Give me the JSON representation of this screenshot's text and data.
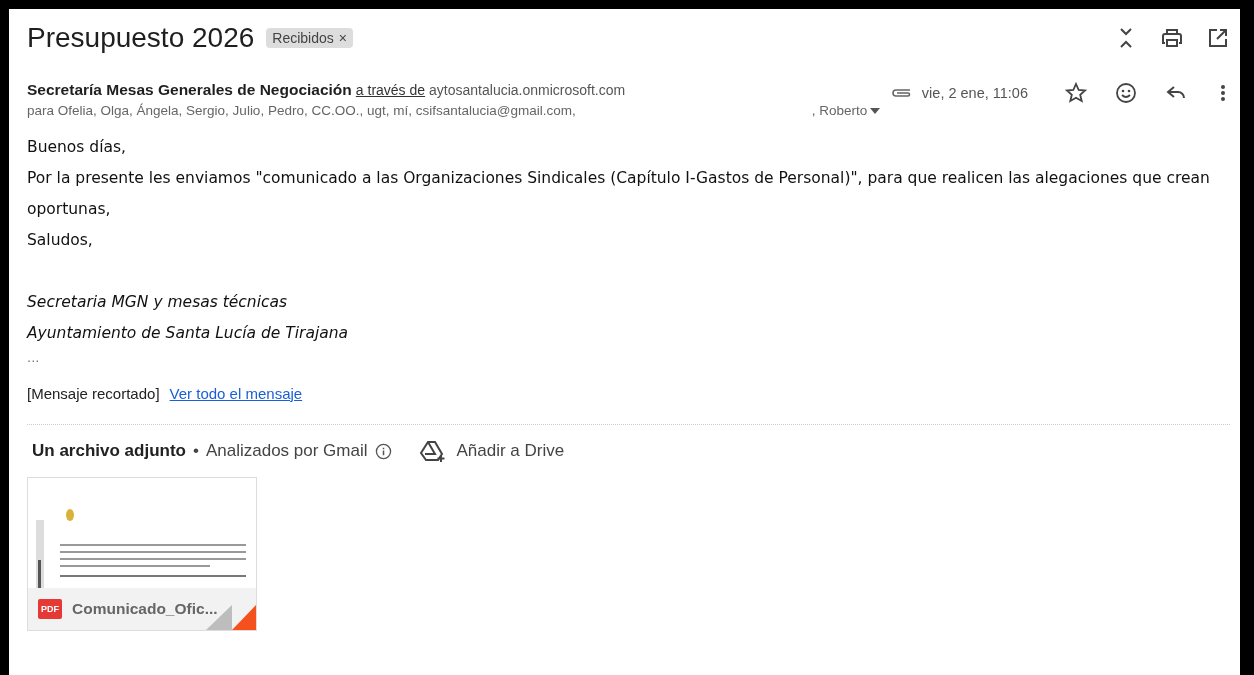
{
  "subject": "Presupuesto 2026",
  "label": {
    "text": "Recibidos",
    "remove": "×"
  },
  "sender": {
    "name": "Secretaría Mesas Generales de Negociación",
    "via_link": "a través de",
    "via_domain": "aytosantalucia.onmicrosoft.com"
  },
  "recipients": {
    "visible": "para Ofelia, Olga, Ángela, Sergio, Julio, Pedro, CC.OO., ugt, mí, csifsantalucia@gmail.com,",
    "tail": ", Roberto"
  },
  "date": "vie, 2 ene, 11:06",
  "has_attachment": true,
  "starred": false,
  "body": [
    {
      "kind": "text",
      "text": "Buenos días,"
    },
    {
      "kind": "text",
      "text": "Por la presente les enviamos \"comunicado a las Organizaciones Sindicales (Capítulo I-Gastos de Personal)\", para que realicen las alegaciones que crean oportunas,"
    },
    {
      "kind": "text",
      "text": "Saludos,"
    },
    {
      "kind": "gap"
    },
    {
      "kind": "signature",
      "text": "Secretaria MGN  y mesas técnicas"
    },
    {
      "kind": "signature",
      "text": "Ayuntamiento de Santa Lucía de Tirajana"
    },
    {
      "kind": "ellipsis",
      "text": "..."
    }
  ],
  "clipped": {
    "note": "[Mensaje recortado]",
    "link": "Ver todo el mensaje"
  },
  "attachments_header": {
    "count": "Un archivo adjunto",
    "dot": "•",
    "scanned": "Analizados por Gmail",
    "drive": "Añadir a Drive"
  },
  "attachments": [
    {
      "kind": "pdf",
      "badge": "PDF",
      "name": "Comunicado_Ofic..."
    }
  ]
}
